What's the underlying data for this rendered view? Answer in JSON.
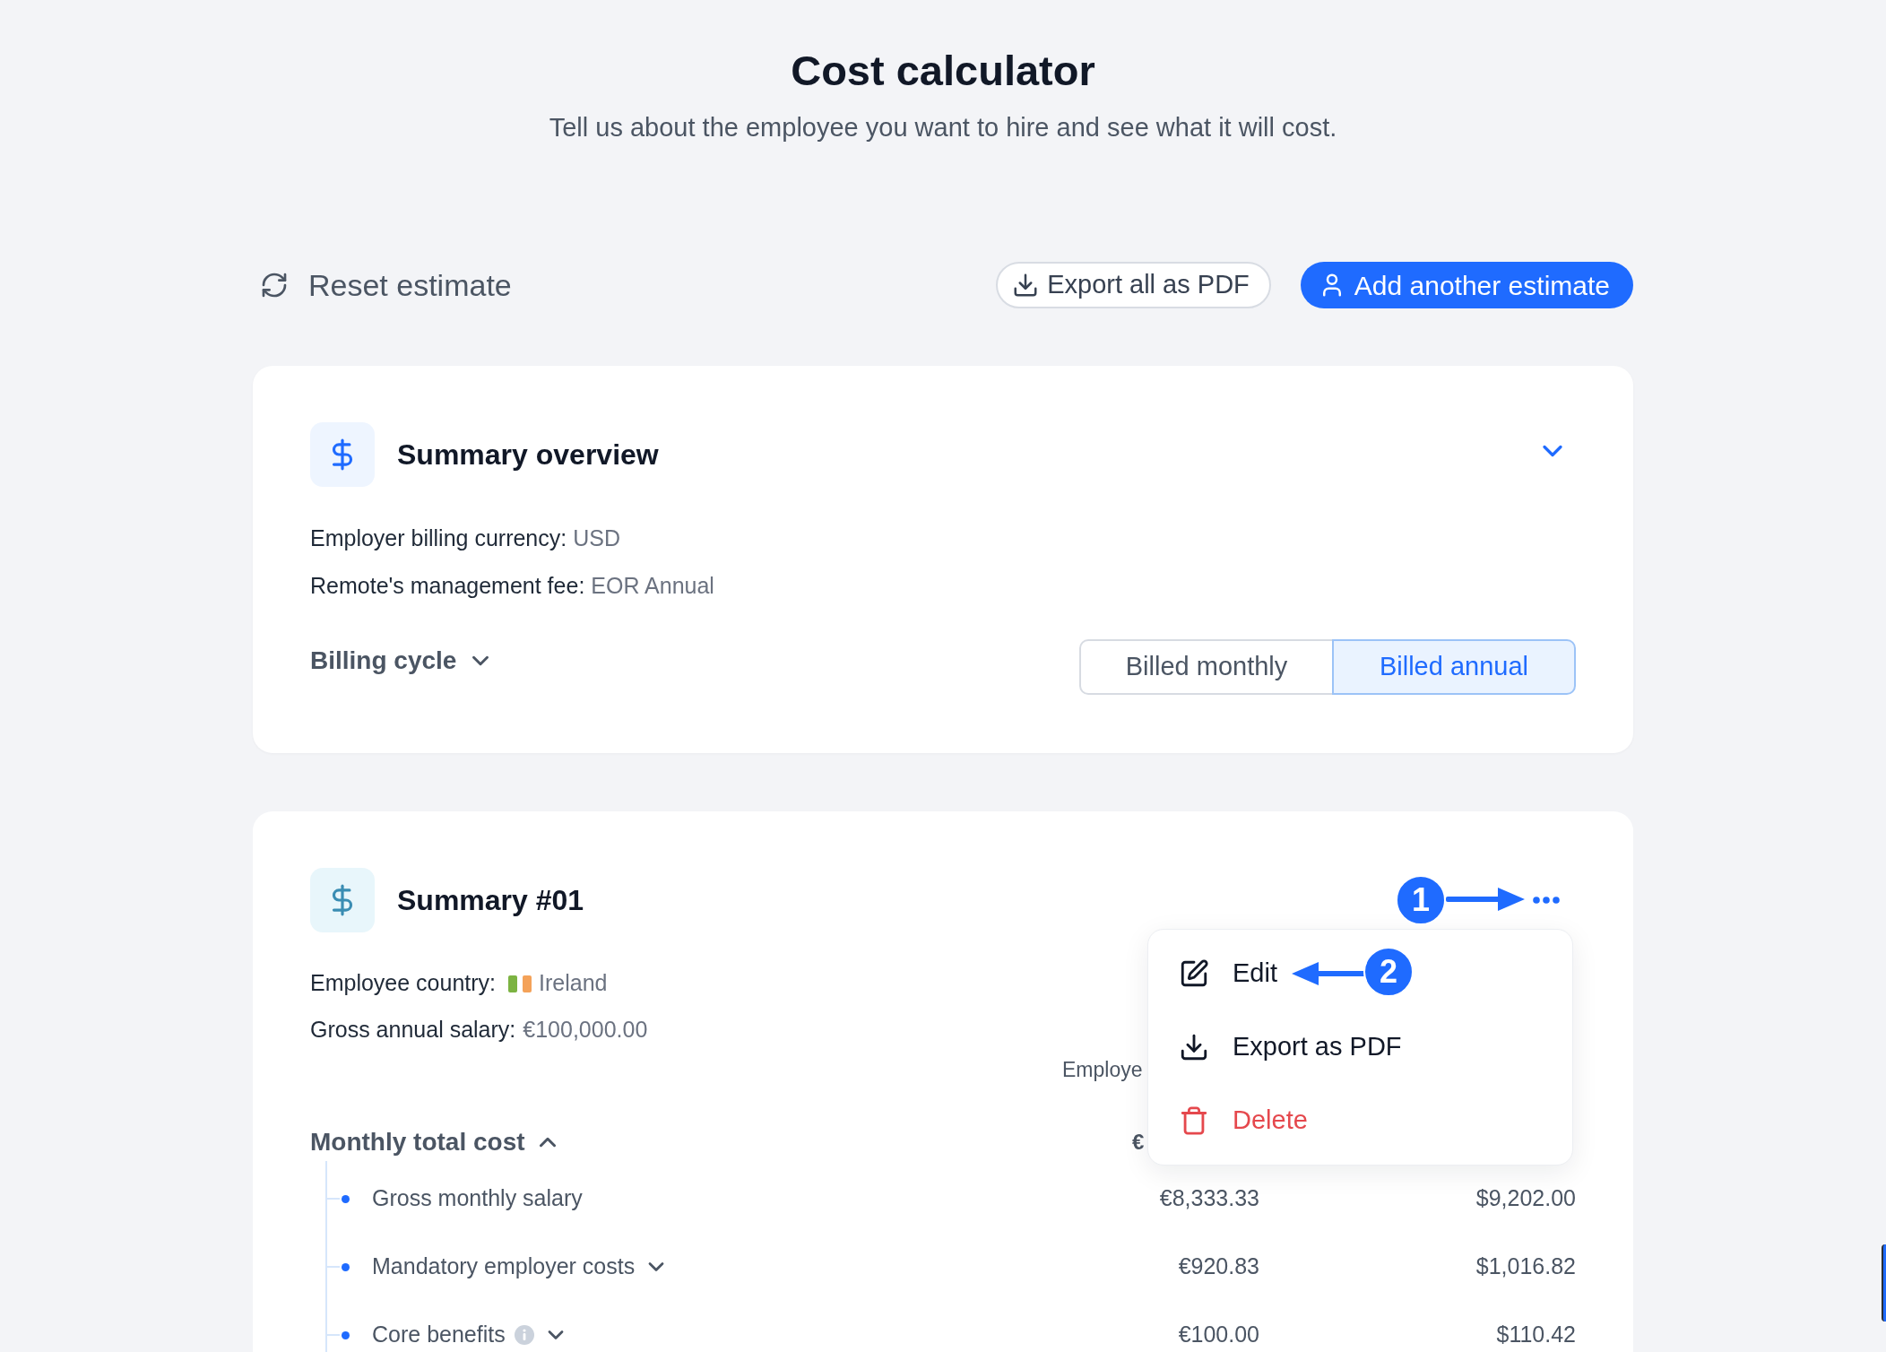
{
  "header": {
    "title": "Cost calculator",
    "subtitle": "Tell us about the employee you want to hire and see what it will cost."
  },
  "toolbar": {
    "reset": "Reset estimate",
    "buttons": [
      {
        "label": "Export all as PDF",
        "kind": "outline"
      },
      {
        "label": "Add another estimate",
        "kind": "primary"
      }
    ]
  },
  "overview": {
    "title": "Summary overview",
    "fields": [
      {
        "label": "Employer billing currency:",
        "value": "USD"
      },
      {
        "label": "Remote's management fee:",
        "value": "EOR Annual"
      }
    ],
    "billing_cycle": {
      "label": "Billing cycle",
      "options": [
        {
          "label": "Billed monthly",
          "selected": false
        },
        {
          "label": "Billed annual",
          "selected": true
        }
      ]
    }
  },
  "summary": {
    "title": "Summary #01",
    "fields": [
      {
        "kind": "country",
        "label": "Employee country:",
        "value": "Ireland"
      },
      {
        "kind": "text",
        "label": "Gross annual salary:",
        "value": "€100,000.00"
      }
    ],
    "columns": [
      "Employe"
    ],
    "section": {
      "label": "Monthly total cost",
      "expanded": true,
      "column_1": "€",
      "rows": [
        {
          "label": "Gross monthly salary",
          "info": false,
          "expandable": false,
          "column_1": "€8,333.33",
          "column_2": "$9,202.00"
        },
        {
          "label": "Mandatory employer costs",
          "info": false,
          "expandable": true,
          "expanded": false,
          "column_1": "€920.83",
          "column_2": "$1,016.82"
        },
        {
          "label": "Core benefits",
          "info": true,
          "expandable": true,
          "expanded": false,
          "column_1": "€100.00",
          "column_2": "$110.42"
        }
      ]
    }
  },
  "menu": {
    "items": [
      {
        "kind": "edit",
        "label": "Edit"
      },
      {
        "kind": "export",
        "label": "Export as PDF"
      },
      {
        "kind": "delete",
        "label": "Delete"
      }
    ]
  },
  "annotations": [
    {
      "label": "1"
    },
    {
      "label": "2"
    }
  ]
}
